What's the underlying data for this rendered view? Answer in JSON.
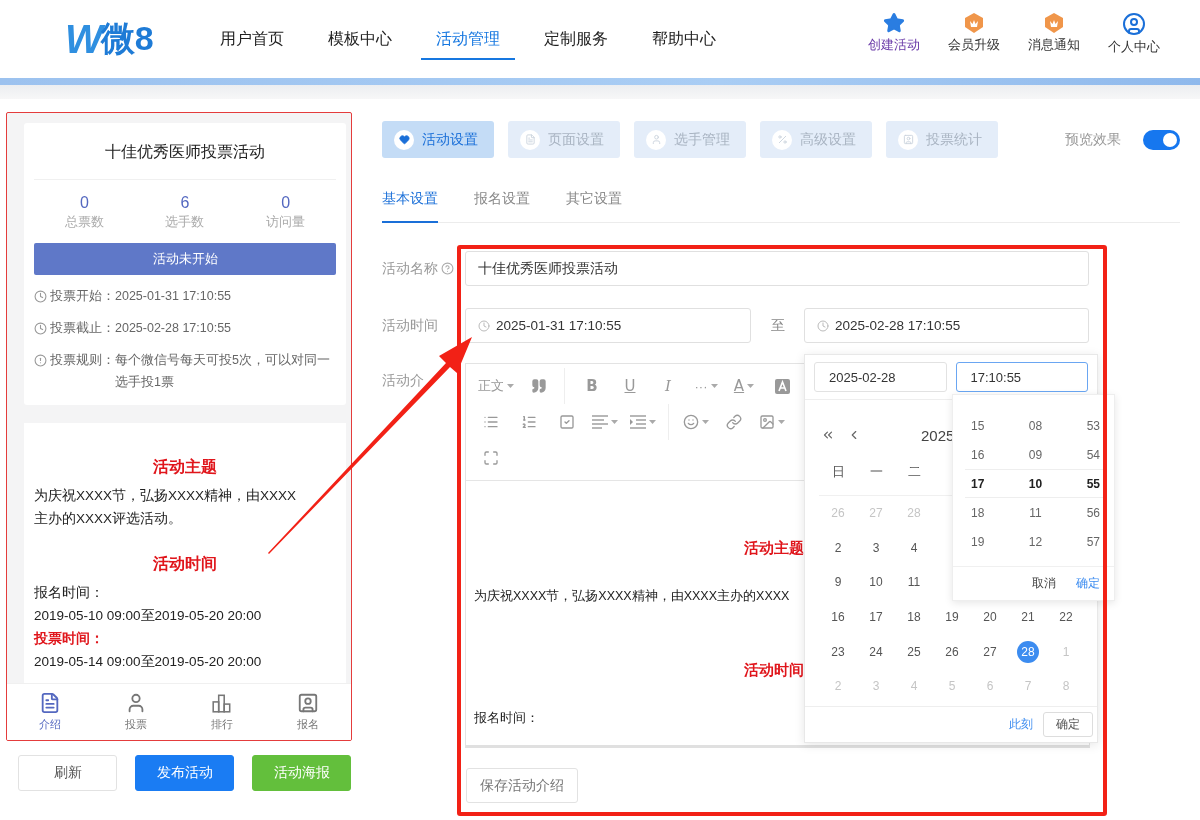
{
  "header": {
    "logo": {
      "mark": "W",
      "text": "微8"
    },
    "nav": [
      {
        "label": "用户首页",
        "selected": false
      },
      {
        "label": "模板中心",
        "selected": false
      },
      {
        "label": "活动管理",
        "selected": true
      },
      {
        "label": "定制服务",
        "selected": false
      },
      {
        "label": "帮助中心",
        "selected": false
      }
    ],
    "actions": [
      {
        "label": "创建活动",
        "kind": "star",
        "accent": true
      },
      {
        "label": "会员升级",
        "kind": "medal",
        "accent": false
      },
      {
        "label": "消息通知",
        "kind": "medal",
        "accent": false
      },
      {
        "label": "个人中心",
        "kind": "user",
        "accent": false
      }
    ]
  },
  "preview": {
    "title": "十佳优秀医师投票活动",
    "stats": [
      {
        "value": "0",
        "label": "总票数"
      },
      {
        "value": "6",
        "label": "选手数"
      },
      {
        "value": "0",
        "label": "访问量"
      }
    ],
    "status_button": "活动未开始",
    "info": [
      {
        "kind": "clock",
        "label": "投票开始：",
        "value": "2025-01-31 17:10:55"
      },
      {
        "kind": "clock",
        "label": "投票截止：",
        "value": "2025-02-28 17:10:55"
      },
      {
        "kind": "alert",
        "label": "投票规则：",
        "value": "每个微信号每天可投5次，可以对同一选手投1票"
      }
    ],
    "content": [
      {
        "kind": "heading",
        "text": "活动主题"
      },
      {
        "kind": "text",
        "text": "为庆祝XXXX节，弘扬XXXX精神，由XXXX主办的XXXX评选活动。"
      },
      {
        "kind": "heading",
        "text": "活动时间"
      },
      {
        "kind": "text",
        "text": "报名时间："
      },
      {
        "kind": "text",
        "text": "2019-05-10 09:00至2019-05-20 20:00"
      },
      {
        "kind": "label",
        "text": "投票时间："
      },
      {
        "kind": "text",
        "text": "2019-05-14 09:00至2019-05-20 20:00"
      }
    ],
    "tabbar": [
      {
        "label": "介绍",
        "kind": "doc",
        "selected": true
      },
      {
        "label": "投票",
        "kind": "user",
        "selected": false
      },
      {
        "label": "排行",
        "kind": "rank",
        "selected": false
      },
      {
        "label": "报名",
        "kind": "card",
        "selected": false
      }
    ]
  },
  "buttons": [
    {
      "label": "刷新",
      "kind": "default"
    },
    {
      "label": "发布活动",
      "kind": "primary"
    },
    {
      "label": "活动海报",
      "kind": "success"
    }
  ],
  "settings": {
    "tabs": [
      {
        "label": "活动设置",
        "kind": "heart",
        "selected": true
      },
      {
        "label": "页面设置",
        "kind": "page",
        "selected": false
      },
      {
        "label": "选手管理",
        "kind": "user",
        "selected": false
      },
      {
        "label": "高级设置",
        "kind": "percent",
        "selected": false
      },
      {
        "label": "投票统计",
        "kind": "card",
        "selected": false
      }
    ],
    "preview_toggle": {
      "label": "预览效果",
      "on": true
    },
    "subtabs": [
      {
        "label": "基本设置",
        "selected": true
      },
      {
        "label": "报名设置",
        "selected": false
      },
      {
        "label": "其它设置",
        "selected": false
      }
    ],
    "name": {
      "label": "活动名称",
      "value": "十佳优秀医师投票活动"
    },
    "time": {
      "label": "活动时间",
      "start": "2025-01-31 17:10:55",
      "separator": "至",
      "end": "2025-02-28 17:10:55"
    },
    "intro": {
      "label": "活动介",
      "toolbar": [
        [
          {
            "kind": "text",
            "text": "正文",
            "caret": true
          },
          {
            "kind": "quote",
            "caret": false
          },
          {
            "kind": "divider"
          },
          {
            "kind": "bold",
            "text": "B",
            "caret": false
          },
          {
            "kind": "underline",
            "text": "U",
            "caret": false
          },
          {
            "kind": "italic",
            "text": "I",
            "caret": false
          },
          {
            "kind": "text",
            "text": "···",
            "caret": true
          },
          {
            "kind": "color",
            "text": "A",
            "caret": true
          },
          {
            "kind": "highlight",
            "caret": false
          }
        ],
        [
          {
            "kind": "bullets",
            "caret": false
          },
          {
            "kind": "numbers",
            "caret": false
          },
          {
            "kind": "todo",
            "caret": false
          },
          {
            "kind": "align",
            "caret": true
          },
          {
            "kind": "indent",
            "caret": true
          },
          {
            "kind": "divider"
          },
          {
            "kind": "emoji",
            "caret": true
          },
          {
            "kind": "link",
            "caret": false
          },
          {
            "kind": "image",
            "caret": true
          }
        ],
        [
          {
            "kind": "fullscreen",
            "caret": false
          }
        ]
      ],
      "content": [
        {
          "kind": "heading",
          "text": "活动主题"
        },
        {
          "kind": "text",
          "text": "为庆祝XXXX节，弘扬XXXX精神，由XXXX主办的XXXX"
        },
        {
          "kind": "heading",
          "text": "活动时间"
        },
        {
          "kind": "text",
          "text": "报名时间："
        }
      ],
      "save_button": "保存活动介绍"
    },
    "date_picker": {
      "date_value": "2025-02-28",
      "time_value": "17:10:55",
      "title": "2025",
      "weekdays": [
        "日",
        "一",
        "二"
      ],
      "weeks": [
        [
          {
            "day": "26",
            "muted": true,
            "selected": false
          },
          {
            "day": "27",
            "muted": true,
            "selected": false
          },
          {
            "day": "28",
            "muted": true,
            "selected": false
          }
        ],
        [
          {
            "day": "2",
            "muted": false,
            "selected": false
          },
          {
            "day": "3",
            "muted": false,
            "selected": false
          },
          {
            "day": "4",
            "muted": false,
            "selected": false
          }
        ],
        [
          {
            "day": "9",
            "muted": false,
            "selected": false
          },
          {
            "day": "10",
            "muted": false,
            "selected": false
          },
          {
            "day": "11",
            "muted": false,
            "selected": false
          }
        ],
        [
          {
            "day": "16",
            "muted": false,
            "selected": false
          },
          {
            "day": "17",
            "muted": false,
            "selected": false
          },
          {
            "day": "18",
            "muted": false,
            "selected": false
          },
          {
            "day": "19",
            "muted": false,
            "selected": false
          },
          {
            "day": "20",
            "muted": false,
            "selected": false
          },
          {
            "day": "21",
            "muted": false,
            "selected": false
          },
          {
            "day": "22",
            "muted": false,
            "selected": false
          }
        ],
        [
          {
            "day": "23",
            "muted": false,
            "selected": false
          },
          {
            "day": "24",
            "muted": false,
            "selected": false
          },
          {
            "day": "25",
            "muted": false,
            "selected": false
          },
          {
            "day": "26",
            "muted": false,
            "selected": false
          },
          {
            "day": "27",
            "muted": false,
            "selected": false
          },
          {
            "day": "28",
            "muted": false,
            "selected": true
          },
          {
            "day": "1",
            "muted": true,
            "selected": false
          }
        ],
        [
          {
            "day": "2",
            "muted": true,
            "selected": false
          },
          {
            "day": "3",
            "muted": true,
            "selected": false
          },
          {
            "day": "4",
            "muted": true,
            "selected": false
          },
          {
            "day": "5",
            "muted": true,
            "selected": false
          },
          {
            "day": "6",
            "muted": true,
            "selected": false
          },
          {
            "day": "7",
            "muted": true,
            "selected": false
          },
          {
            "day": "8",
            "muted": true,
            "selected": false
          }
        ]
      ],
      "now": "此刻",
      "ok": "确定",
      "time_panel": {
        "rows": [
          {
            "cells": [
              "15",
              "08",
              "53"
            ],
            "selected": false
          },
          {
            "cells": [
              "16",
              "09",
              "54"
            ],
            "selected": false
          },
          {
            "cells": [
              "17",
              "10",
              "55"
            ],
            "selected": true
          },
          {
            "cells": [
              "18",
              "11",
              "56"
            ],
            "selected": false
          },
          {
            "cells": [
              "19",
              "12",
              "57"
            ],
            "selected": false
          }
        ],
        "cancel": "取消",
        "ok": "确定"
      }
    }
  }
}
